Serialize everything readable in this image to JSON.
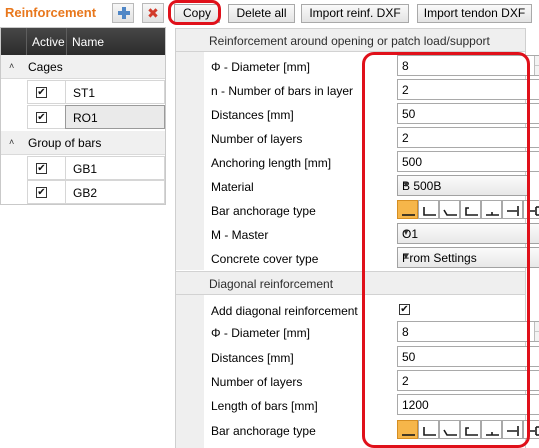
{
  "toolbar": {
    "title": "Reinforcement",
    "add_icon": "add-plus-icon",
    "delete_icon": "delete-x-icon",
    "delete_glyph": "✖",
    "copy_label": "Copy",
    "delete_all_label": "Delete all",
    "import_reinf_label": "Import reinf. DXF",
    "import_tendon_label": "Import tendon DXF",
    "accent_color": "#e8771c",
    "highlight_color": "#e0101a"
  },
  "grid": {
    "columns": [
      "Active",
      "Name"
    ],
    "groups": [
      {
        "label": "Cages",
        "expanded": true,
        "rows": [
          {
            "active": true,
            "name": "ST1",
            "selected": false
          },
          {
            "active": true,
            "name": "RO1",
            "selected": true
          }
        ]
      },
      {
        "label": "Group of bars",
        "expanded": true,
        "rows": [
          {
            "active": true,
            "name": "GB1",
            "selected": false
          },
          {
            "active": true,
            "name": "GB2",
            "selected": false
          }
        ]
      }
    ]
  },
  "panel": {
    "section1": {
      "title": "Reinforcement around opening or patch load/support",
      "diameter_label": "Φ - Diameter [mm]",
      "diameter_value": "8",
      "num_bars_label": "n - Number of bars in layer",
      "num_bars_value": "2",
      "distances_label": "Distances [mm]",
      "distances_value": "50",
      "layers_label": "Number of layers",
      "layers_value": "2",
      "anchoring_label": "Anchoring length [mm]",
      "anchoring_value": "500",
      "material_label": "Material",
      "material_value": "B 500B",
      "anchorage_label": "Bar anchorage type",
      "anchorage_selected_index": 0,
      "master_label": "M - Master",
      "master_value": "O1",
      "cover_label": "Concrete cover type",
      "cover_value": "From Settings"
    },
    "section2": {
      "title": "Diagonal reinforcement",
      "add_diag_label": "Add diagonal reinforcement",
      "add_diag_checked": true,
      "diameter_label": "Φ - Diameter [mm]",
      "diameter_value": "8",
      "distances_label": "Distances [mm]",
      "distances_value": "50",
      "layers_label": "Number of layers",
      "layers_value": "2",
      "length_label": "Length of bars [mm]",
      "length_value": "1200",
      "anchorage_label": "Bar anchorage type",
      "anchorage_selected_index": 0
    },
    "check_glyph": "✔",
    "dropdown_glyph": "▼",
    "spin_up_glyph": "▲",
    "spin_down_glyph": "▼",
    "refresh_glyph": "↻",
    "collapse_glyph": "˄"
  }
}
